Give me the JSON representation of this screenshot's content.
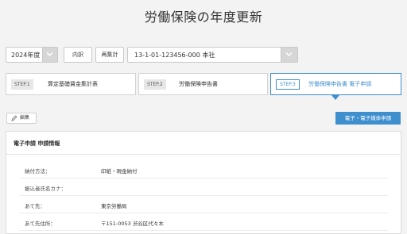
{
  "page": {
    "title": "労働保険の年度更新"
  },
  "controls": {
    "year": "2024年度",
    "btn_breakdown": "内訳",
    "btn_recalc": "再集計",
    "org": "13-1-01-123456-000 本社"
  },
  "steps": [
    {
      "tag": "STEP.1",
      "label": "算定基礎賃金集計表"
    },
    {
      "tag": "STEP.2",
      "label": "労働保険申告書"
    },
    {
      "tag": "STEP.3",
      "label": "労働保険申告書 電子申請"
    }
  ],
  "actions": {
    "edit": "編集",
    "apply": "電子・電子媒体申請"
  },
  "panel": {
    "header": "電子申請 申請情報",
    "rows": [
      {
        "key": "納付方法：",
        "value": "印紙・現金納付"
      },
      {
        "key": "振込者氏名カナ：",
        "value": ""
      },
      {
        "key": "あて先：",
        "value": "東京労働局"
      },
      {
        "key": "あて先住所：",
        "value": "〒151-0053 渋谷区代々木"
      }
    ]
  },
  "colors": {
    "accent": "#3f8fcf"
  },
  "icons": {
    "chevron": "chevron-down-icon",
    "edit": "pencil-icon"
  }
}
